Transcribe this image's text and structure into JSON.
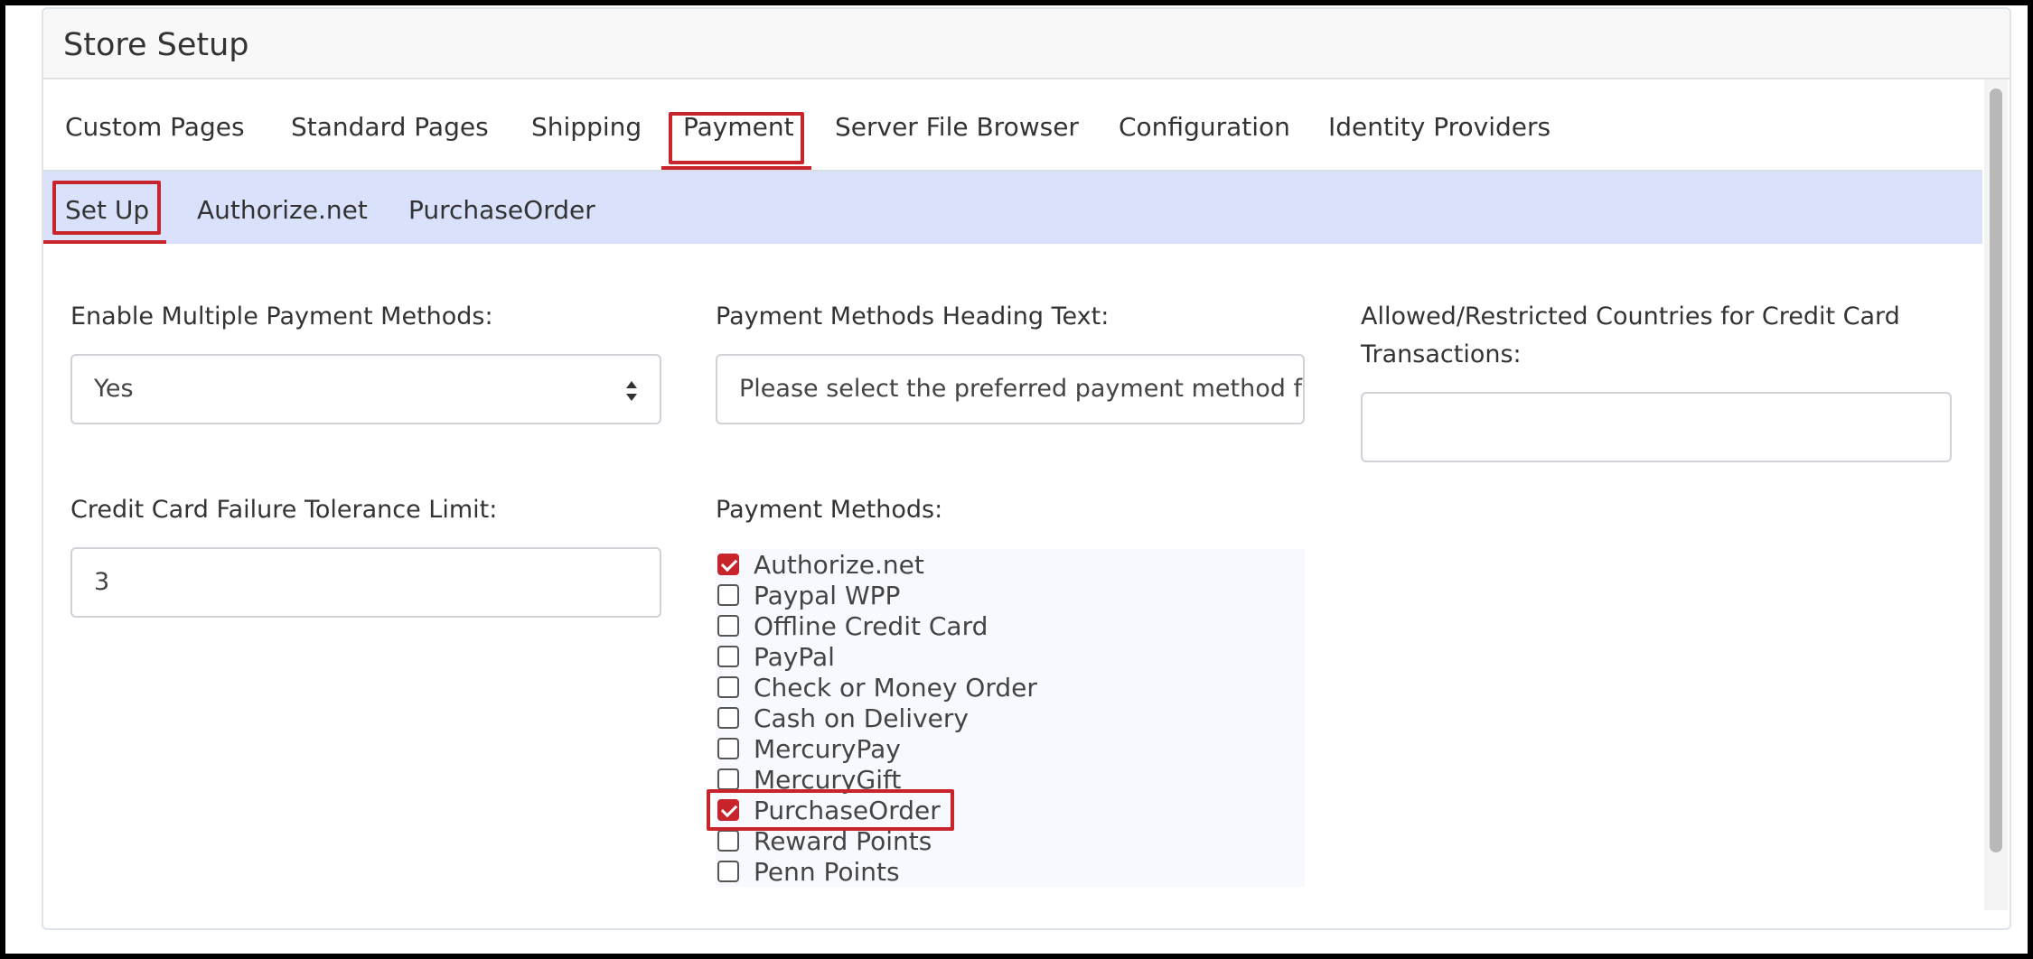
{
  "panel": {
    "title": "Store Setup"
  },
  "tabs": [
    {
      "label": "Custom Pages"
    },
    {
      "label": "Standard Pages"
    },
    {
      "label": "Shipping"
    },
    {
      "label": "Payment"
    },
    {
      "label": "Server File Browser"
    },
    {
      "label": "Configuration"
    },
    {
      "label": "Identity Providers"
    }
  ],
  "active_tab": "Payment",
  "subtabs": [
    {
      "label": "Set Up"
    },
    {
      "label": "Authorize.net"
    },
    {
      "label": "PurchaseOrder"
    }
  ],
  "active_subtab": "Set Up",
  "form": {
    "enable_multiple": {
      "label": "Enable Multiple Payment Methods:",
      "value": "Yes"
    },
    "heading_text": {
      "label": "Payment Methods Heading Text:",
      "value": "Please select the preferred payment method for your order"
    },
    "allowed_countries": {
      "label_line1": "Allowed/Restricted Countries for Credit Card",
      "label_line2": "Transactions:",
      "value": ""
    },
    "failure_limit": {
      "label": "Credit Card Failure Tolerance Limit:",
      "value": "3"
    },
    "payment_methods": {
      "label": "Payment Methods:",
      "items": [
        {
          "label": "Authorize.net",
          "checked": true
        },
        {
          "label": "Paypal WPP",
          "checked": false
        },
        {
          "label": "Offline Credit Card",
          "checked": false
        },
        {
          "label": "PayPal",
          "checked": false
        },
        {
          "label": "Check or Money Order",
          "checked": false
        },
        {
          "label": "Cash on Delivery",
          "checked": false
        },
        {
          "label": "MercuryPay",
          "checked": false
        },
        {
          "label": "MercuryGift",
          "checked": false
        },
        {
          "label": "PurchaseOrder",
          "checked": true
        },
        {
          "label": "Reward Points",
          "checked": false
        },
        {
          "label": "Penn Points",
          "checked": false
        }
      ]
    }
  },
  "colors": {
    "accent": "#c8242b",
    "subtab_bg": "#d9e1fb"
  },
  "icons": {
    "select": "sort-arrows-icon"
  }
}
